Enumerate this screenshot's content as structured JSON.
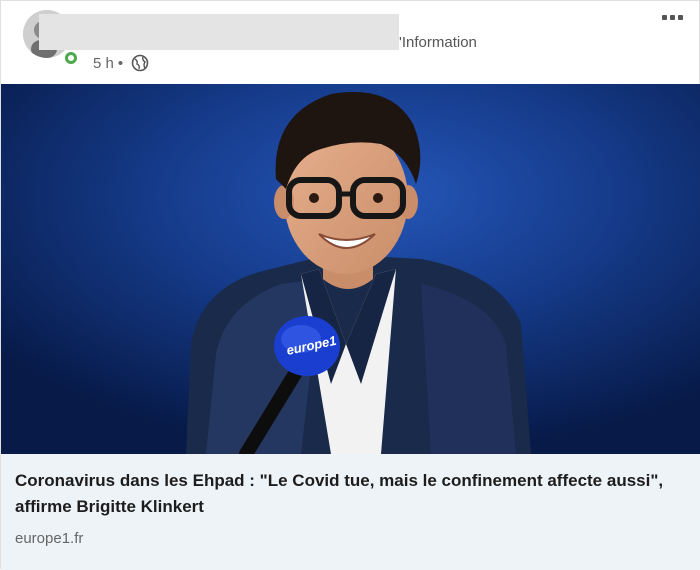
{
  "post": {
    "author_tail": "'Information",
    "time": "5 h",
    "separator": "•",
    "visibility_icon": "globe-icon",
    "menu_icon": "more-options-icon"
  },
  "article": {
    "image_subject": "man-with-microphone-photo",
    "mic_label": "europe1",
    "headline": "Coronavirus dans les Ehpad : \"Le Covid tue, mais le confinement affecte aussi\", affirme Brigitte Klinkert",
    "source": "europe1.fr"
  },
  "colors": {
    "photo_background": "#133784",
    "footer_background": "#eef3f8",
    "presence": "#4ca94c"
  }
}
